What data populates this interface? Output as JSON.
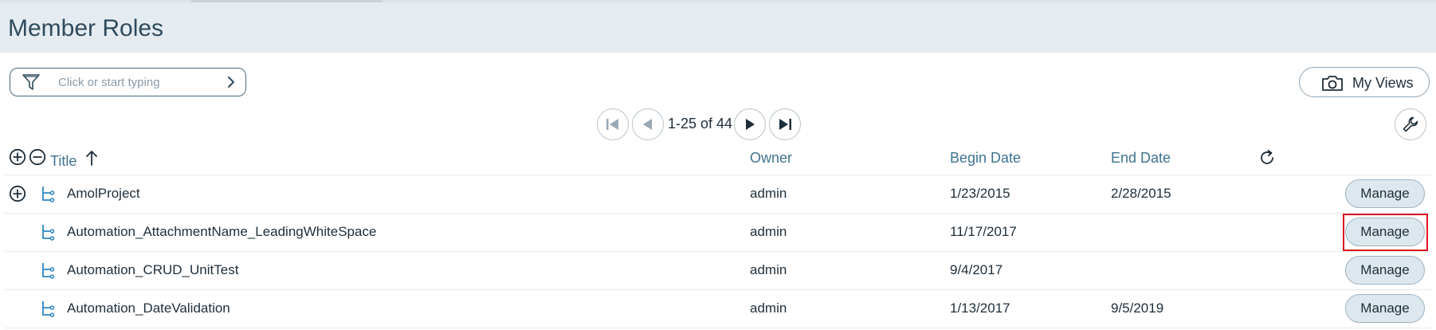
{
  "page": {
    "title": "Member Roles"
  },
  "filter": {
    "placeholder": "Click or start typing"
  },
  "views": {
    "label": "My Views"
  },
  "pager": {
    "range_text": "1-25 of 44"
  },
  "columns": {
    "title": "Title",
    "owner": "Owner",
    "begin_date": "Begin Date",
    "end_date": "End Date"
  },
  "rows": [
    {
      "title": "AmolProject",
      "owner": "admin",
      "begin_date": "1/23/2015",
      "end_date": "2/28/2015",
      "action": "Manage",
      "expandable": true
    },
    {
      "title": "Automation_AttachmentName_LeadingWhiteSpace",
      "owner": "admin",
      "begin_date": "11/17/2017",
      "end_date": "",
      "action": "Manage",
      "expandable": false
    },
    {
      "title": "Automation_CRUD_UnitTest",
      "owner": "admin",
      "begin_date": "9/4/2017",
      "end_date": "",
      "action": "Manage",
      "expandable": false
    },
    {
      "title": "Automation_DateValidation",
      "owner": "admin",
      "begin_date": "1/13/2017",
      "end_date": "9/5/2019",
      "action": "Manage",
      "expandable": false
    }
  ],
  "colors": {
    "header_bg": "#e4ecf2",
    "link_blue": "#3f7390",
    "tree_icon_blue": "#2f86c4",
    "highlight_red": "#e0141e",
    "manage_bg": "#dde7ee"
  },
  "icons": {
    "filter": "funnel-icon",
    "filter_submit": "chevron-right-icon",
    "views": "camera-icon",
    "first_page": "first-page-icon",
    "prev_page": "prev-page-icon",
    "next_page": "next-page-icon",
    "last_page": "last-page-icon",
    "settings": "wrench-icon",
    "expand_all": "expand-all-icon",
    "collapse_all": "collapse-all-icon",
    "sort": "sort-ascending-icon",
    "refresh": "refresh-icon",
    "row_expand": "expand-row-icon",
    "hierarchy": "hierarchy-icon"
  }
}
